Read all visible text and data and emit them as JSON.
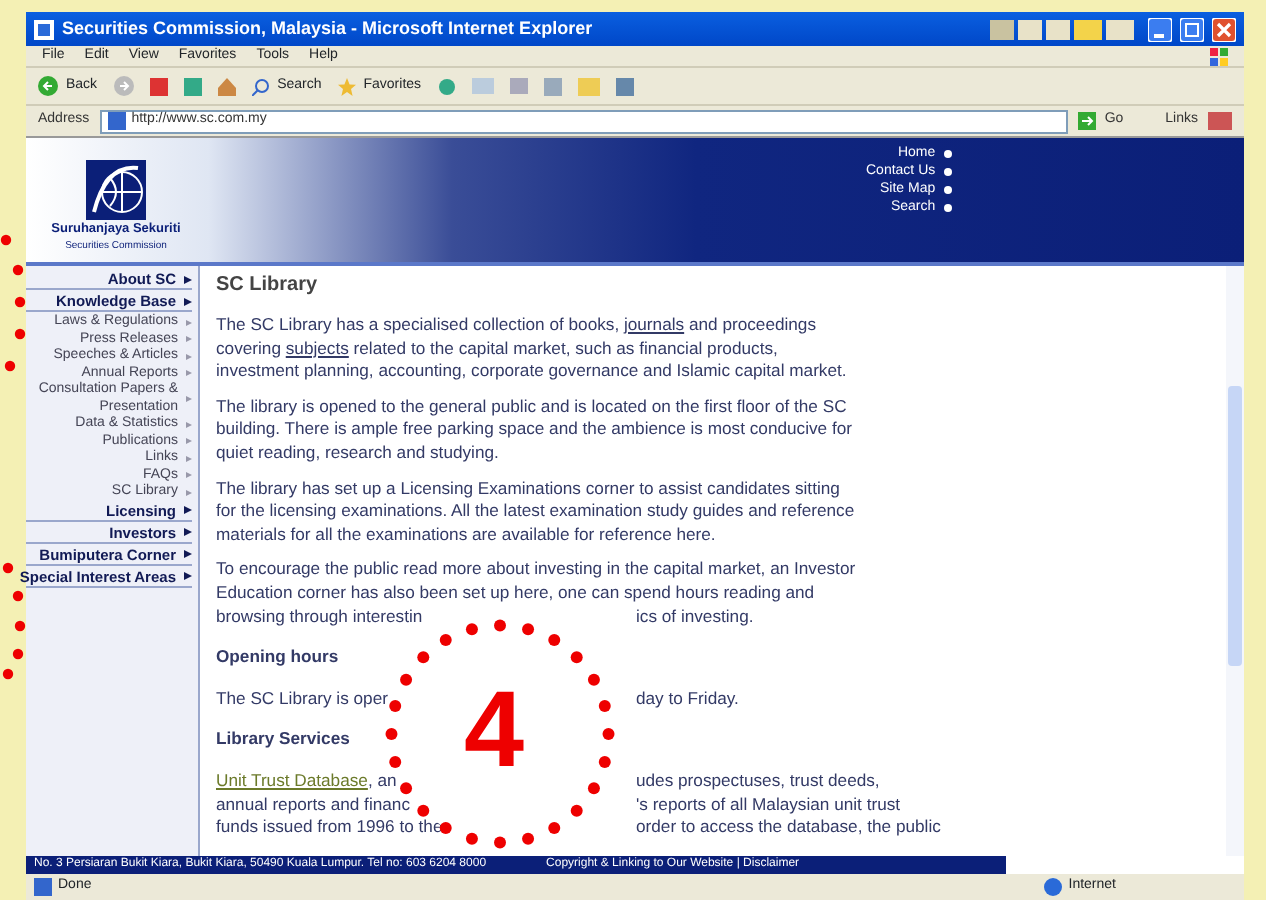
{
  "window": {
    "title": "Securities Commission, Malaysia - Microsoft Internet Explorer"
  },
  "menu": [
    "File",
    "Edit",
    "View",
    "Favorites",
    "Tools",
    "Help"
  ],
  "toolbar": [
    "Back",
    "Search",
    "Favorites"
  ],
  "address": {
    "label": "Address",
    "value": "http://www.sc.com.my",
    "go": "Go",
    "links": "Links"
  },
  "header": {
    "logo_title": "Suruhanjaya Sekuriti",
    "logo_subtitle": "Securities Commission",
    "links": [
      "Home",
      "Contact Us",
      "Site Map",
      "Search"
    ]
  },
  "sidebar": {
    "items": [
      {
        "label": "About SC",
        "kind": "section"
      },
      {
        "label": "Knowledge Base",
        "kind": "section"
      },
      {
        "label": "Laws & Regulations",
        "kind": "sub"
      },
      {
        "label": "Press Releases",
        "kind": "sub"
      },
      {
        "label": "Speeches & Articles",
        "kind": "sub"
      },
      {
        "label": "Annual Reports",
        "kind": "sub"
      },
      {
        "label": "Consultation Papers & Presentation",
        "kind": "sub"
      },
      {
        "label": "Data & Statistics",
        "kind": "sub"
      },
      {
        "label": "Publications",
        "kind": "sub"
      },
      {
        "label": "Links",
        "kind": "sub"
      },
      {
        "label": "FAQs",
        "kind": "sub"
      },
      {
        "label": "SC Library",
        "kind": "sub"
      },
      {
        "label": "Licensing",
        "kind": "section"
      },
      {
        "label": "Investors",
        "kind": "section"
      },
      {
        "label": "Bumiputera Corner",
        "kind": "section"
      },
      {
        "label": "Special Interest Areas",
        "kind": "section"
      }
    ]
  },
  "content": {
    "title": "SC Library",
    "blocks": [
      {
        "kind": "paragraph",
        "segments": [
          {
            "text": "The SC Library has a specialised collection of books, ",
            "link": false
          },
          {
            "text": "journals",
            "link": true
          },
          {
            "text": " and proceedings covering ",
            "link": false
          },
          {
            "text": "subjects",
            "link": true
          },
          {
            "text": " related to the capital market, such as financial products, investment planning, accounting, corporate governance and Islamic capital market.",
            "link": false
          }
        ]
      },
      {
        "kind": "paragraph",
        "segments": [
          {
            "text": "The library is opened to the general public and is located on the first floor of the SC building. There is ample free parking space and the ambience is most conducive for quiet reading, research and studying.",
            "link": false
          }
        ]
      },
      {
        "kind": "paragraph",
        "segments": [
          {
            "text": "The library has set up a Licensing Examinations corner to assist candidates sitting for the licensing examinations. All the latest examination study guides and reference materials for all the examinations are available for reference here.",
            "link": false
          }
        ]
      },
      {
        "kind": "lines",
        "lines": [
          {
            "left": "To encourage the public read more about investing in the capital market, an Investor"
          },
          {
            "left": "Education corner has also been set up here, one can spend hours reading and"
          },
          {
            "left": "browsing through interestin",
            "right": "ics of investing."
          }
        ]
      },
      {
        "kind": "heading",
        "text": "Opening hours"
      },
      {
        "kind": "lines",
        "lines": [
          {
            "left": "The SC Library is oper",
            "right": "day to Friday."
          }
        ]
      },
      {
        "kind": "heading",
        "text": "Library Services"
      },
      {
        "kind": "lines",
        "lines": [
          {
            "left": "Unit Trust Database",
            "link": true,
            "left2": ", an",
            "right": "udes prospectuses, trust deeds,"
          },
          {
            "left": "annual reports and financ",
            "right": "'s reports of all Malaysian unit trust"
          },
          {
            "left": "funds issued from 1996 to the",
            "right": "order to access the database, the public"
          }
        ]
      }
    ]
  },
  "footer": {
    "address": "No. 3 Persiaran Bukit Kiara, Bukit Kiara, 50490 Kuala Lumpur. Tel no: 603 6204 8000",
    "links": "Copyright & Linking to Our Website | Disclaimer"
  },
  "status": {
    "text": "Done",
    "zone": "Internet"
  },
  "annotation": {
    "number": "4"
  }
}
